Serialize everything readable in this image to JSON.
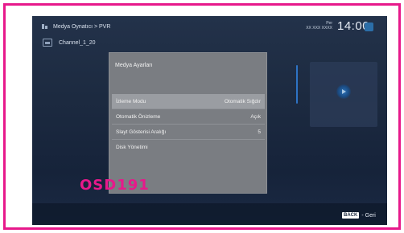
{
  "header": {
    "breadcrumb": "Medya Oynatıcı > PVR",
    "clock": {
      "day": "Per",
      "date": "XX XXX XXXX",
      "time": "14:00"
    }
  },
  "file_list": {
    "items": [
      {
        "label": "Channel_1_20"
      }
    ]
  },
  "dialog": {
    "title": "Medya Ayarları",
    "items": [
      {
        "label": "İzleme Modu",
        "value": "Otomatik Sığdır",
        "selected": true
      },
      {
        "label": "Otomatik Önizleme",
        "value": "Açık"
      },
      {
        "label": "Slayt Gösterisi Aralığı",
        "value": "5"
      },
      {
        "label": "Disk Yönetimi",
        "value": ""
      }
    ]
  },
  "footer": {
    "back_key": "BACK",
    "back_label": "- Geri"
  },
  "watermark": "OSD191",
  "colors": {
    "frame_border": "#e7198b",
    "background": "#1c2a40",
    "dialog_bg": "#7a7d82",
    "accent_blue": "#2b6ea8"
  },
  "icons": {
    "breadcrumb": "media-player-icon",
    "file": "video-file-icon",
    "preview": "play-icon"
  }
}
